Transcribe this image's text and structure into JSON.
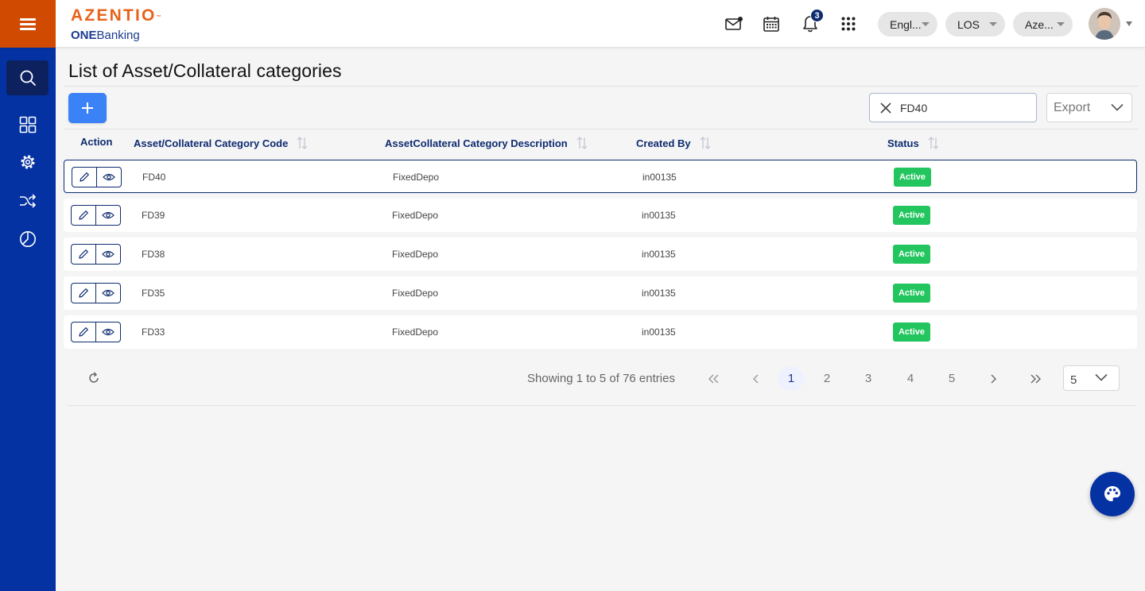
{
  "header": {
    "logo_brand": "AZENTIO",
    "logo_sub_bold": "ONE",
    "logo_sub_rest": "Banking",
    "notification_count": "3",
    "language": "Engl...",
    "module": "LOS",
    "entity": "Aze..."
  },
  "sidebar": {
    "items": [
      {
        "name": "search",
        "active": true
      },
      {
        "name": "dashboard",
        "active": false
      },
      {
        "name": "settings",
        "active": false
      },
      {
        "name": "workflow",
        "active": false
      },
      {
        "name": "reports",
        "active": false
      }
    ]
  },
  "page": {
    "title": "List of Asset/Collateral categories"
  },
  "toolbar": {
    "search_value": "FD40",
    "export_label": "Export"
  },
  "table": {
    "columns": [
      "Action",
      "Asset/Collateral Category Code",
      "AssetCollateral Category Description",
      "Created By",
      "Status"
    ],
    "rows": [
      {
        "code": "FD40",
        "description": "FixedDepo",
        "created_by": "in00135",
        "status": "Active",
        "selected": true
      },
      {
        "code": "FD39",
        "description": "FixedDepo",
        "created_by": "in00135",
        "status": "Active",
        "selected": false
      },
      {
        "code": "FD38",
        "description": "FixedDepo",
        "created_by": "in00135",
        "status": "Active",
        "selected": false
      },
      {
        "code": "FD35",
        "description": "FixedDepo",
        "created_by": "in00135",
        "status": "Active",
        "selected": false
      },
      {
        "code": "FD33",
        "description": "FixedDepo",
        "created_by": "in00135",
        "status": "Active",
        "selected": false
      }
    ]
  },
  "pagination": {
    "showing_text": "Showing 1 to 5 of 76 entries",
    "pages": [
      "1",
      "2",
      "3",
      "4",
      "5"
    ],
    "current_page": "1",
    "per_page": "5"
  },
  "colors": {
    "accent_orange": "#d04a02",
    "sidebar_blue": "#0432a2",
    "primary_blue": "#3b82f6",
    "status_green": "#22c55e",
    "header_navy": "#0d2b6e"
  }
}
